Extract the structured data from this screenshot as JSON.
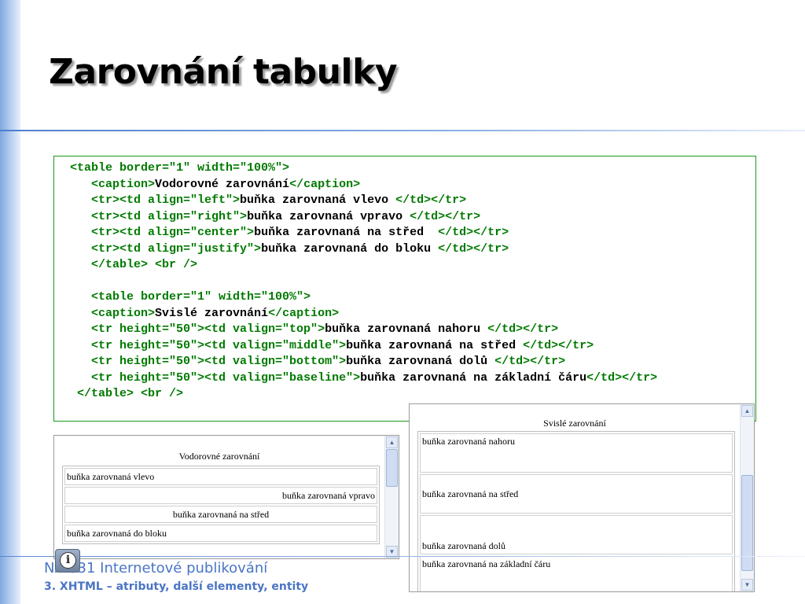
{
  "slide": {
    "title": "Zarovnání tabulky"
  },
  "code": {
    "lines": [
      [
        {
          "t": "tag",
          "v": "<table border=\"1\" width=\"100%\">"
        }
      ],
      [
        {
          "t": "txt",
          "v": "   "
        },
        {
          "t": "tag",
          "v": "<caption>"
        },
        {
          "t": "txt",
          "v": "Vodorovné zarovnání"
        },
        {
          "t": "tag",
          "v": "</caption>"
        }
      ],
      [
        {
          "t": "txt",
          "v": "   "
        },
        {
          "t": "tag",
          "v": "<tr><td align=\"left\">"
        },
        {
          "t": "txt",
          "v": "buňka zarovnaná vlevo "
        },
        {
          "t": "tag",
          "v": "</td></tr>"
        }
      ],
      [
        {
          "t": "txt",
          "v": "   "
        },
        {
          "t": "tag",
          "v": "<tr><td align=\"right\">"
        },
        {
          "t": "txt",
          "v": "buňka zarovnaná vpravo "
        },
        {
          "t": "tag",
          "v": "</td></tr>"
        }
      ],
      [
        {
          "t": "txt",
          "v": "   "
        },
        {
          "t": "tag",
          "v": "<tr><td align=\"center\">"
        },
        {
          "t": "txt",
          "v": "buňka zarovnaná na střed  "
        },
        {
          "t": "tag",
          "v": "</td></tr>"
        }
      ],
      [
        {
          "t": "txt",
          "v": "   "
        },
        {
          "t": "tag",
          "v": "<tr><td align=\"justify\">"
        },
        {
          "t": "txt",
          "v": "buňka zarovnaná do bloku "
        },
        {
          "t": "tag",
          "v": "</td></tr>"
        }
      ],
      [
        {
          "t": "txt",
          "v": "   "
        },
        {
          "t": "tag",
          "v": "</table> <br />"
        }
      ],
      [
        {
          "t": "txt",
          "v": " "
        }
      ],
      [
        {
          "t": "txt",
          "v": "   "
        },
        {
          "t": "tag",
          "v": "<table border=\"1\" width=\"100%\">"
        }
      ],
      [
        {
          "t": "txt",
          "v": "   "
        },
        {
          "t": "tag",
          "v": "<caption>"
        },
        {
          "t": "txt",
          "v": "Svislé zarovnání"
        },
        {
          "t": "tag",
          "v": "</caption>"
        }
      ],
      [
        {
          "t": "txt",
          "v": "   "
        },
        {
          "t": "tag",
          "v": "<tr height=\"50\"><td valign=\"top\">"
        },
        {
          "t": "txt",
          "v": "buňka zarovnaná nahoru "
        },
        {
          "t": "tag",
          "v": "</td></tr>"
        }
      ],
      [
        {
          "t": "txt",
          "v": "   "
        },
        {
          "t": "tag",
          "v": "<tr height=\"50\"><td valign=\"middle\">"
        },
        {
          "t": "txt",
          "v": "buňka zarovnaná na střed "
        },
        {
          "t": "tag",
          "v": "</td></tr>"
        }
      ],
      [
        {
          "t": "txt",
          "v": "   "
        },
        {
          "t": "tag",
          "v": "<tr height=\"50\"><td valign=\"bottom\">"
        },
        {
          "t": "txt",
          "v": "buňka zarovnaná dolů "
        },
        {
          "t": "tag",
          "v": "</td></tr>"
        }
      ],
      [
        {
          "t": "txt",
          "v": "   "
        },
        {
          "t": "tag",
          "v": "<tr height=\"50\"><td valign=\"baseline\">"
        },
        {
          "t": "txt",
          "v": "buňka zarovnaná na základní čáru"
        },
        {
          "t": "tag",
          "v": "</td></tr>"
        }
      ],
      [
        {
          "t": "txt",
          "v": " "
        },
        {
          "t": "tag",
          "v": "</table> <br />"
        }
      ]
    ]
  },
  "preview_horizontal": {
    "caption": "Vodorovné zarovnání",
    "rows": [
      {
        "text": "buňka zarovnaná vlevo",
        "align": "left"
      },
      {
        "text": "buňka zarovnaná vpravo",
        "align": "right"
      },
      {
        "text": "buňka zarovnaná na střed",
        "align": "center"
      },
      {
        "text": "buňka zarovnaná do bloku",
        "align": "justify"
      }
    ]
  },
  "preview_vertical": {
    "caption": "Svislé zarovnání",
    "rows": [
      {
        "text": "buňka zarovnaná nahoru",
        "valign": "top"
      },
      {
        "text": "buňka zarovnaná na střed",
        "valign": "middle"
      },
      {
        "text": "buňka zarovnaná dolů",
        "valign": "bottom"
      },
      {
        "text": "buňka zarovnaná na základní čáru",
        "valign": "baseline"
      }
    ]
  },
  "footer": {
    "course": "NAI031 Internetové publikování",
    "topic": "3. XHTML – atributy, další elementy, entity",
    "info_icon": "info-icon"
  },
  "colors": {
    "tag": "#007a00",
    "accent": "#4a75c4",
    "code_border": "#1a9a1a"
  }
}
